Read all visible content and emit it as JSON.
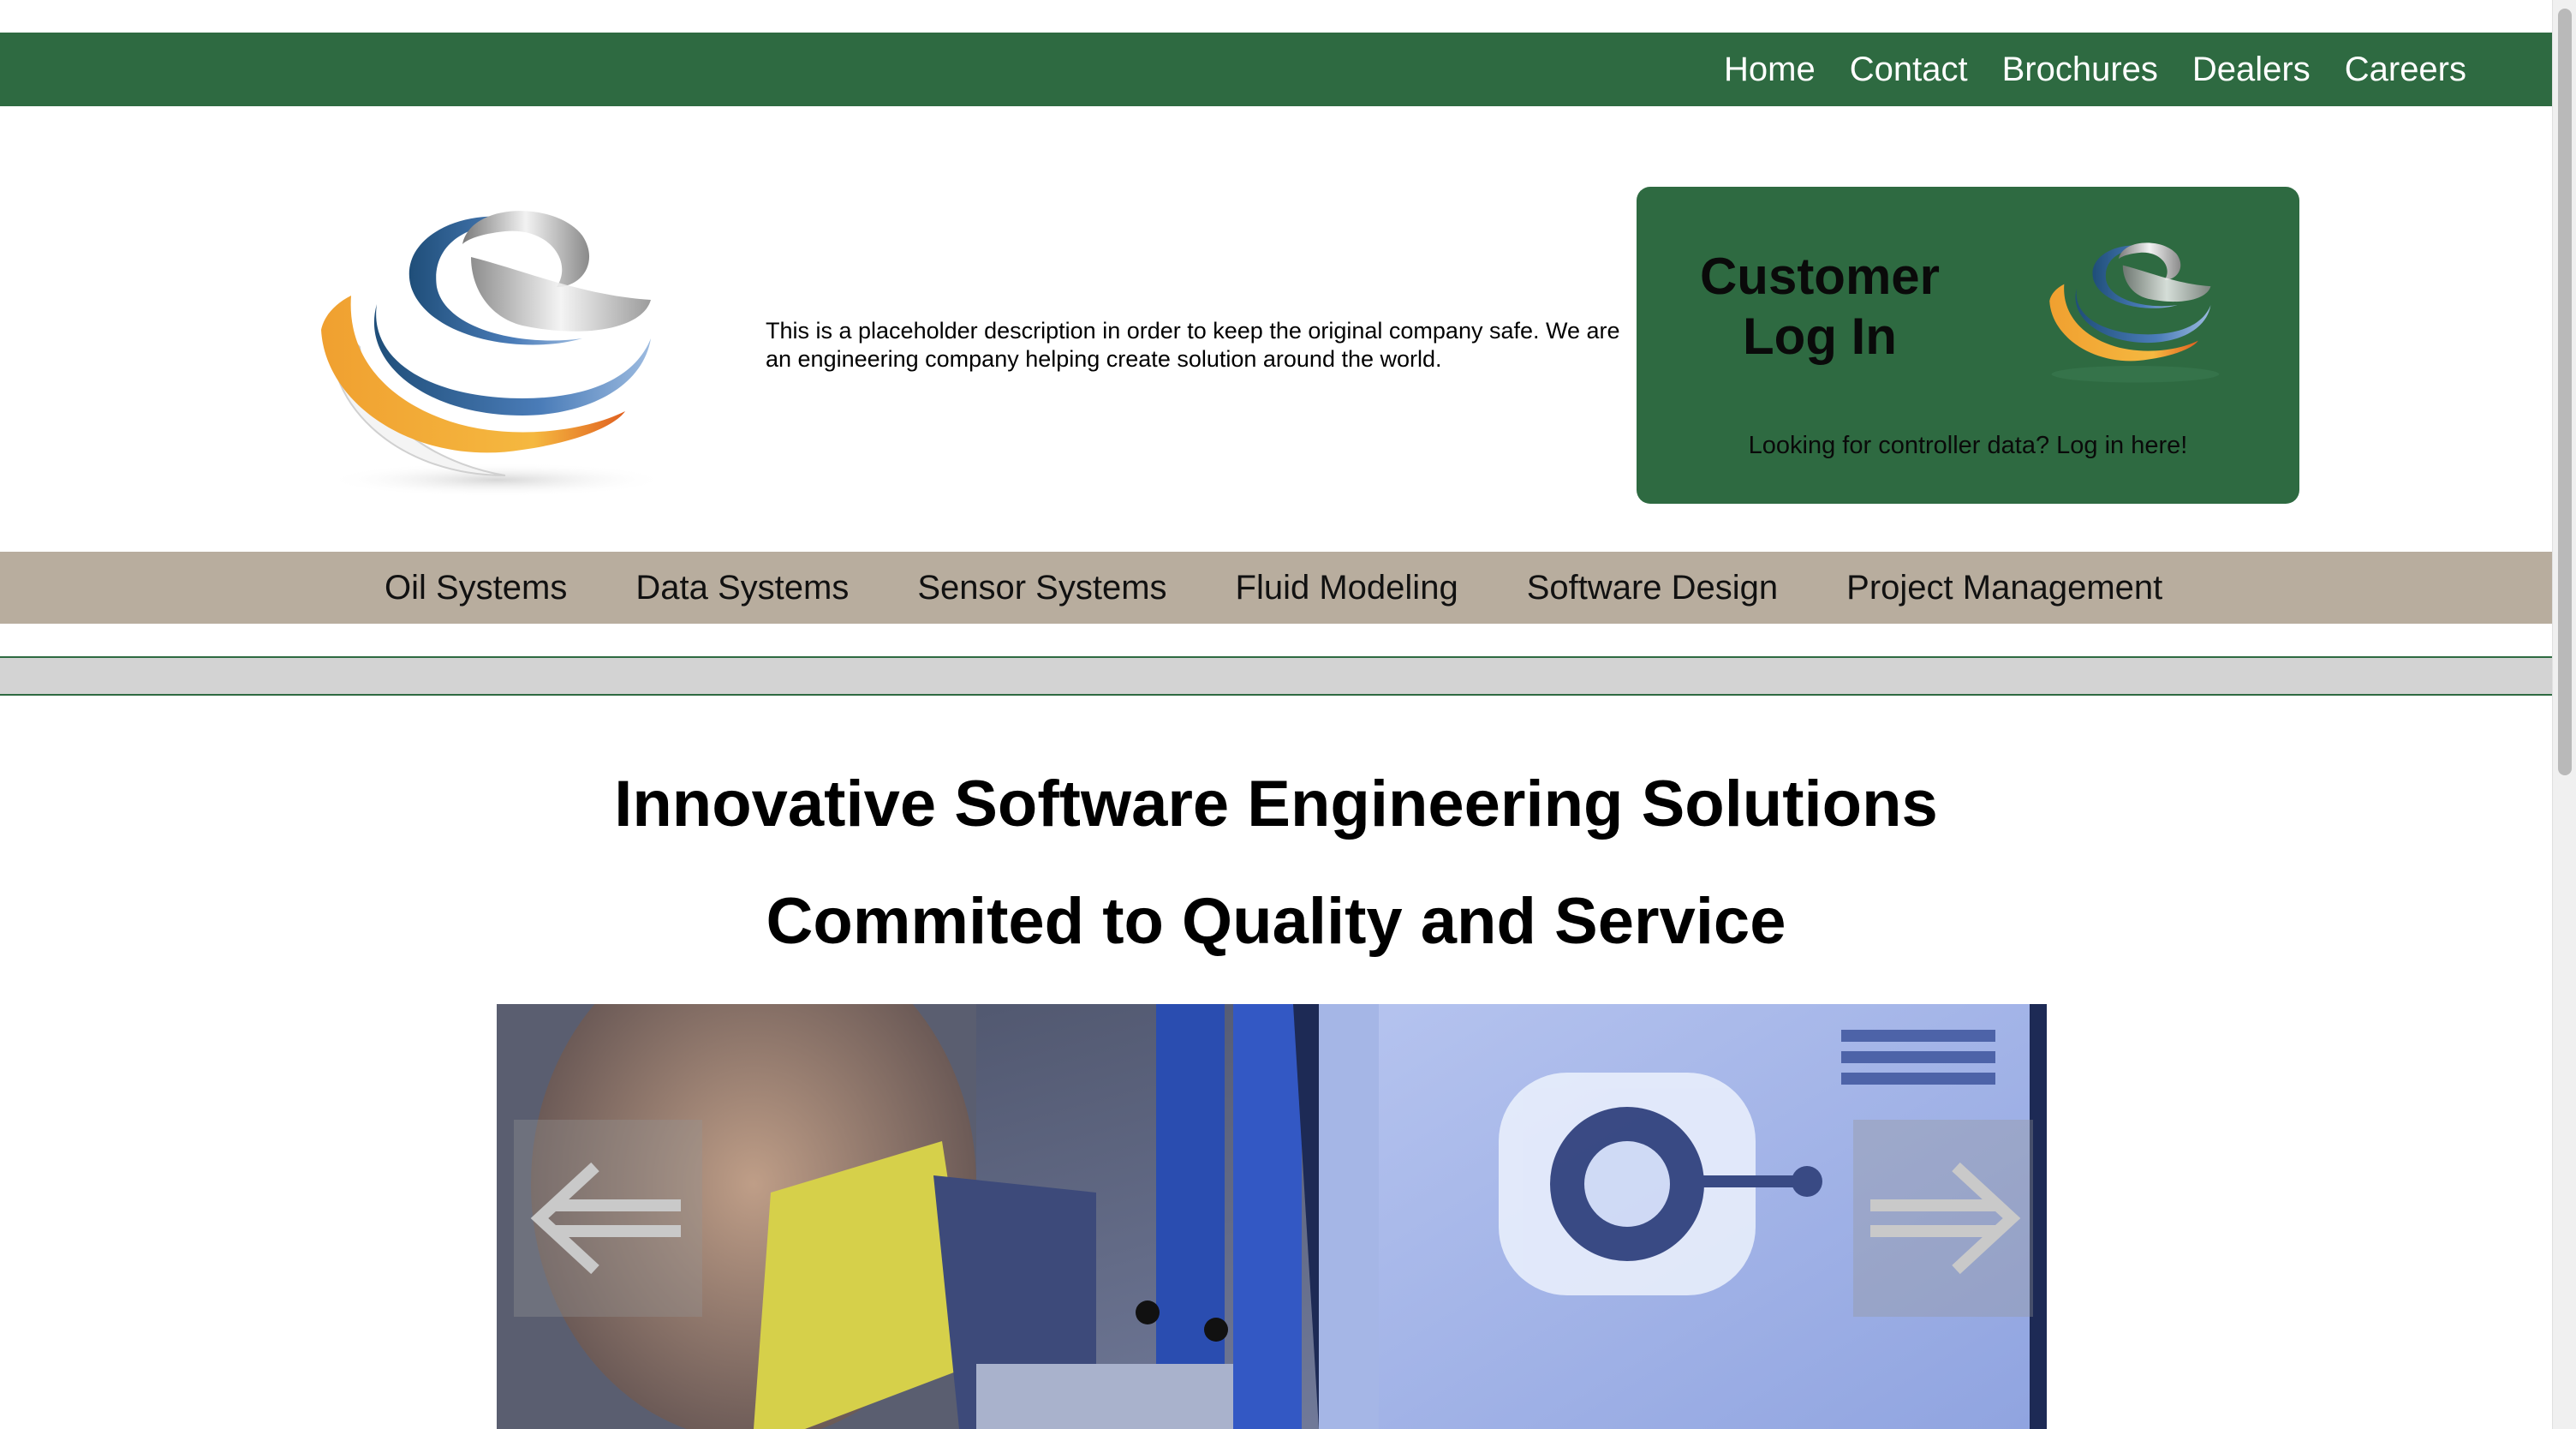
{
  "top_nav": {
    "items": [
      {
        "label": "Home"
      },
      {
        "label": "Contact"
      },
      {
        "label": "Brochures"
      },
      {
        "label": "Dealers"
      },
      {
        "label": "Careers"
      }
    ]
  },
  "header": {
    "logo_icon": "globe-swirl-logo",
    "description": "This is a placeholder description in order to keep the original company safe. We are an engineering company helping create solution around the world."
  },
  "login_box": {
    "title": "Customer\nLog In",
    "subtitle": "Looking for controller data? Log in here!"
  },
  "category_nav": {
    "items": [
      {
        "label": "Oil Systems"
      },
      {
        "label": "Data Systems"
      },
      {
        "label": "Sensor Systems"
      },
      {
        "label": "Fluid Modeling"
      },
      {
        "label": "Software Design"
      },
      {
        "label": "Project Management"
      }
    ]
  },
  "main": {
    "headline": "Innovative Software Engineering Solutions",
    "subheadline": "Commited to Quality and Service"
  },
  "carousel": {
    "prev_icon": "left-double-arrow-icon",
    "next_icon": "right-double-arrow-icon",
    "image": "engineer-with-cad-monitor-photo"
  },
  "colors": {
    "brand_green": "#2e6a41",
    "category_bar": "#b8ad9e",
    "strip_grey": "#d3d3d3"
  }
}
